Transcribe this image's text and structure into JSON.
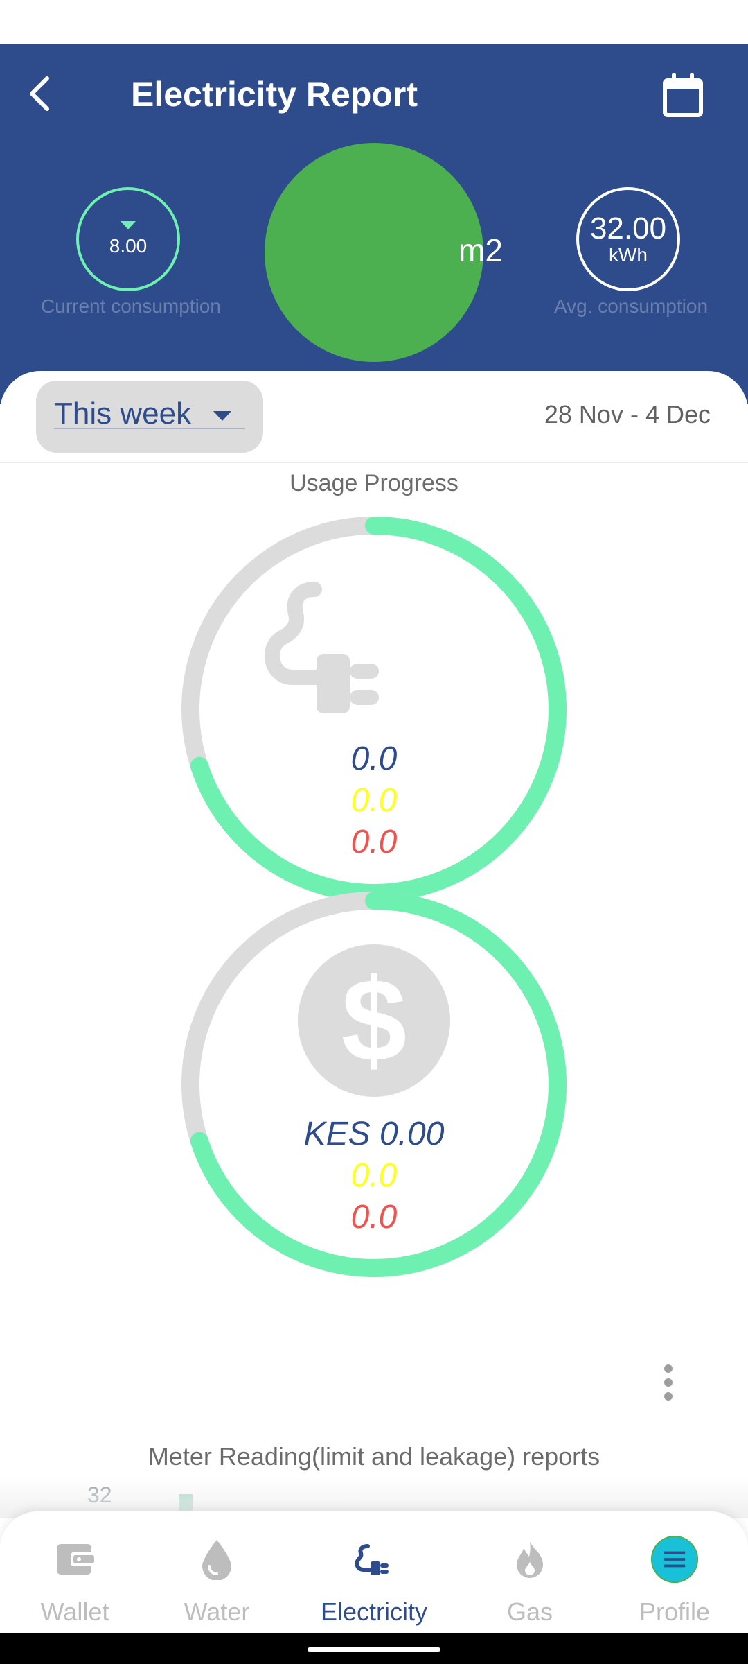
{
  "header": {
    "title": "Electricity Report",
    "back_icon": "back-arrow-icon",
    "calendar_icon": "calendar-icon"
  },
  "stats": {
    "current": {
      "value": "8.00",
      "label": "Current consumption",
      "indicator_icon": "triangle-down-icon"
    },
    "center": {
      "unit": "m2"
    },
    "average": {
      "value": "32.00",
      "unit": "kWh",
      "label": "Avg. consumption"
    }
  },
  "filter": {
    "period": "This week",
    "date_range": "28 Nov - 4 Dec"
  },
  "usage": {
    "title": "Usage Progress",
    "energy": {
      "icon": "plug-icon",
      "values": [
        "0.0",
        "0.0",
        "0.0"
      ],
      "progress": 0.7
    },
    "cost": {
      "icon": "dollar-icon",
      "values": [
        "KES 0.00",
        "0.0",
        "0.0"
      ],
      "progress": 0.7
    }
  },
  "meter": {
    "title": "Meter Reading(limit and leakage) reports",
    "axis_top": "32"
  },
  "nav": {
    "items": [
      {
        "label": "Wallet",
        "icon": "wallet-icon"
      },
      {
        "label": "Water",
        "icon": "water-drop-icon"
      },
      {
        "label": "Electricity",
        "icon": "plug-icon"
      },
      {
        "label": "Gas",
        "icon": "flame-icon"
      },
      {
        "label": "Profile",
        "icon": "menu-icon"
      }
    ],
    "active": "Electricity"
  },
  "colors": {
    "header_bg": "#2e4c8b",
    "accent_green": "#6ef0b0",
    "big_circle": "#4caf50",
    "value_blue": "#2e4c8b",
    "value_yellow": "#ffff22",
    "value_red": "#ef5350",
    "profile_bg": "#18c1d8"
  }
}
